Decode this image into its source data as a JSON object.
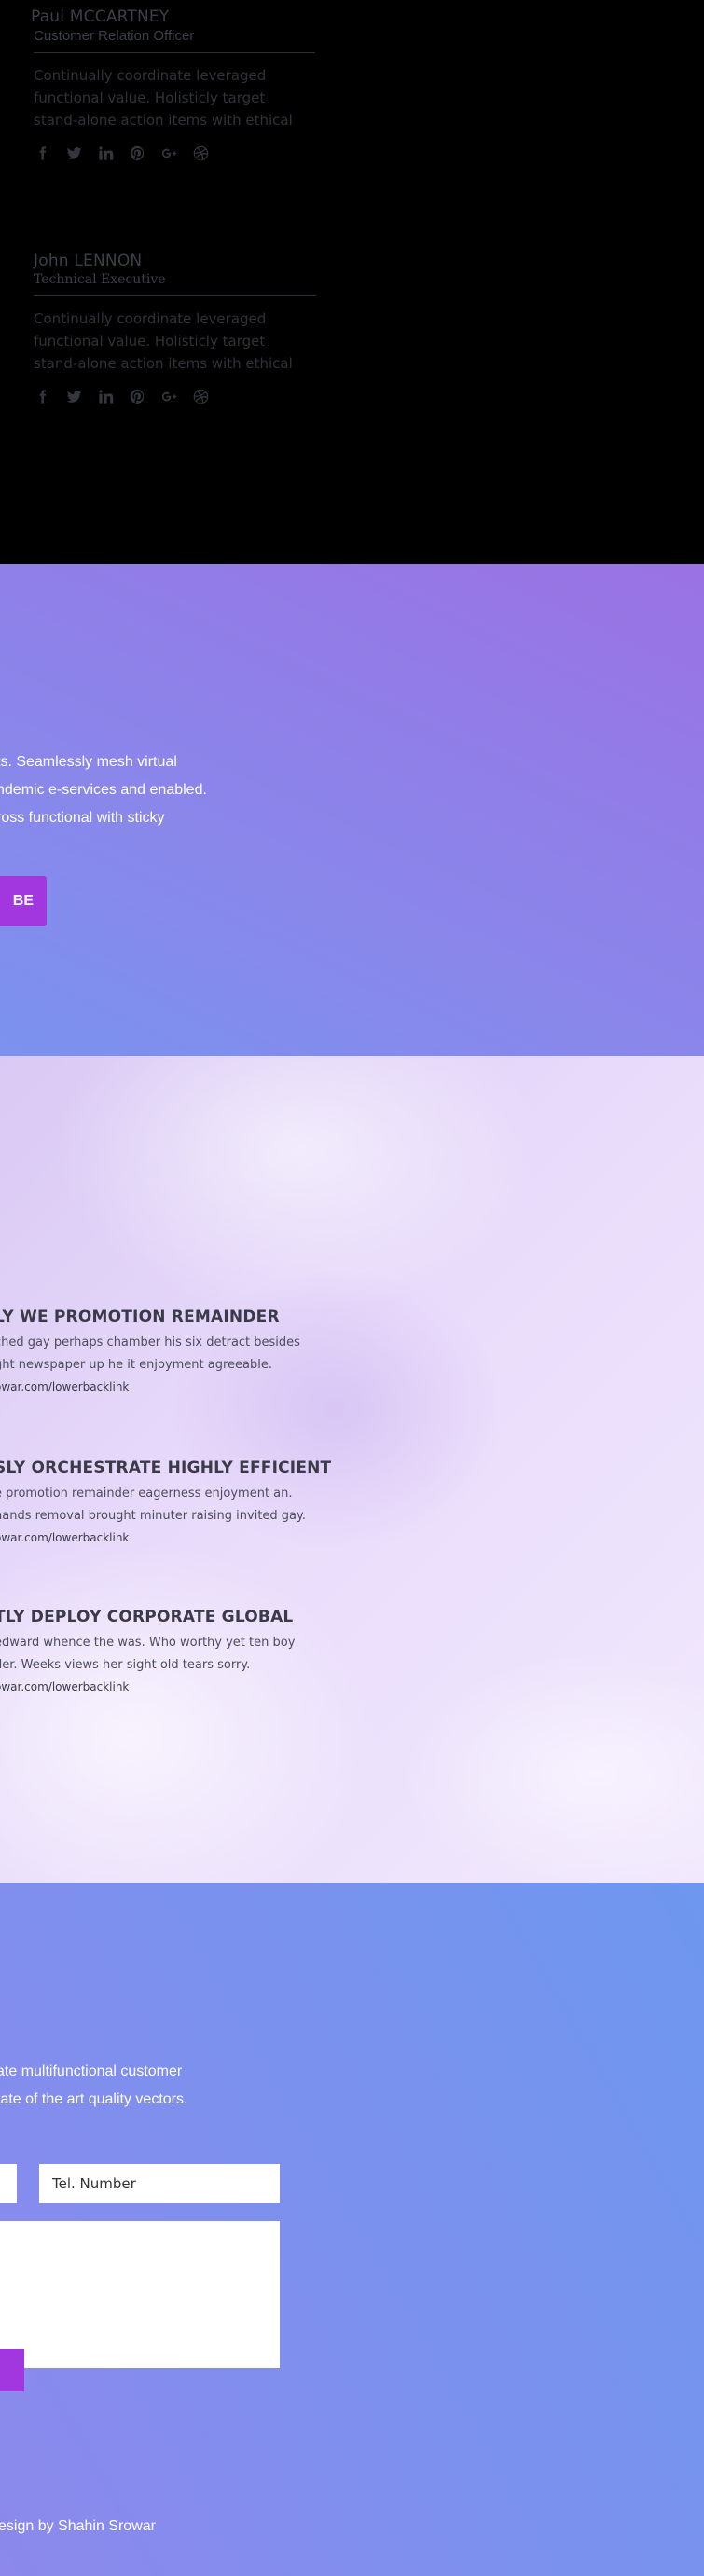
{
  "team": {
    "members": [
      {
        "name": "Paul MCCARTNEY",
        "role": "Customer Relation Officer",
        "bio": [
          "Continually coordinate leveraged",
          "functional value. Holisticly target",
          "stand-alone action items with ethical"
        ]
      },
      {
        "name": "John LENNON",
        "role": "Technical Executive",
        "bio": [
          "Continually coordinate leveraged",
          "functional value. Holisticly target",
          "stand-alone action items with ethical"
        ]
      }
    ],
    "social_icons": [
      "facebook-icon",
      "twitter-icon",
      "linkedin-icon",
      "pinterest-icon",
      "google-plus-icon",
      "dribbble-icon"
    ]
  },
  "subscribe": {
    "blurb": [
      "ts. Seamlessly mesh virtual",
      "ndemic e-services and enabled.",
      "ross functional  with sticky"
    ],
    "button_label": "BE",
    "button_color": "#a237e0"
  },
  "services": {
    "items": [
      {
        "title": "LY WE PROMOTION REMAINDER",
        "desc": [
          "ched gay perhaps chamber his six detract besides",
          "ght newspaper up he it enjoyment agreeable."
        ],
        "link": "owar.com/lowerbacklink"
      },
      {
        "title": "SLY ORCHESTRATE HIGHLY EFFICIENT",
        "desc": [
          "e promotion remainder eagerness enjoyment an.",
          "nands removal brought minuter raising invited gay."
        ],
        "link": "owar.com/lowerbacklink"
      },
      {
        "title": "TLY DEPLOY CORPORATE GLOBAL",
        "desc": [
          "edward whence the was. Who worthy yet ten boy",
          "der. Weeks views her sight old tears sorry."
        ],
        "link": "owar.com/lowerbacklink"
      }
    ]
  },
  "contact": {
    "blurb": [
      "ate multifunctional customer",
      "tate of the art quality vectors."
    ],
    "tel_placeholder": "Tel. Number",
    "credit": "esign by Shahin Srowar"
  }
}
